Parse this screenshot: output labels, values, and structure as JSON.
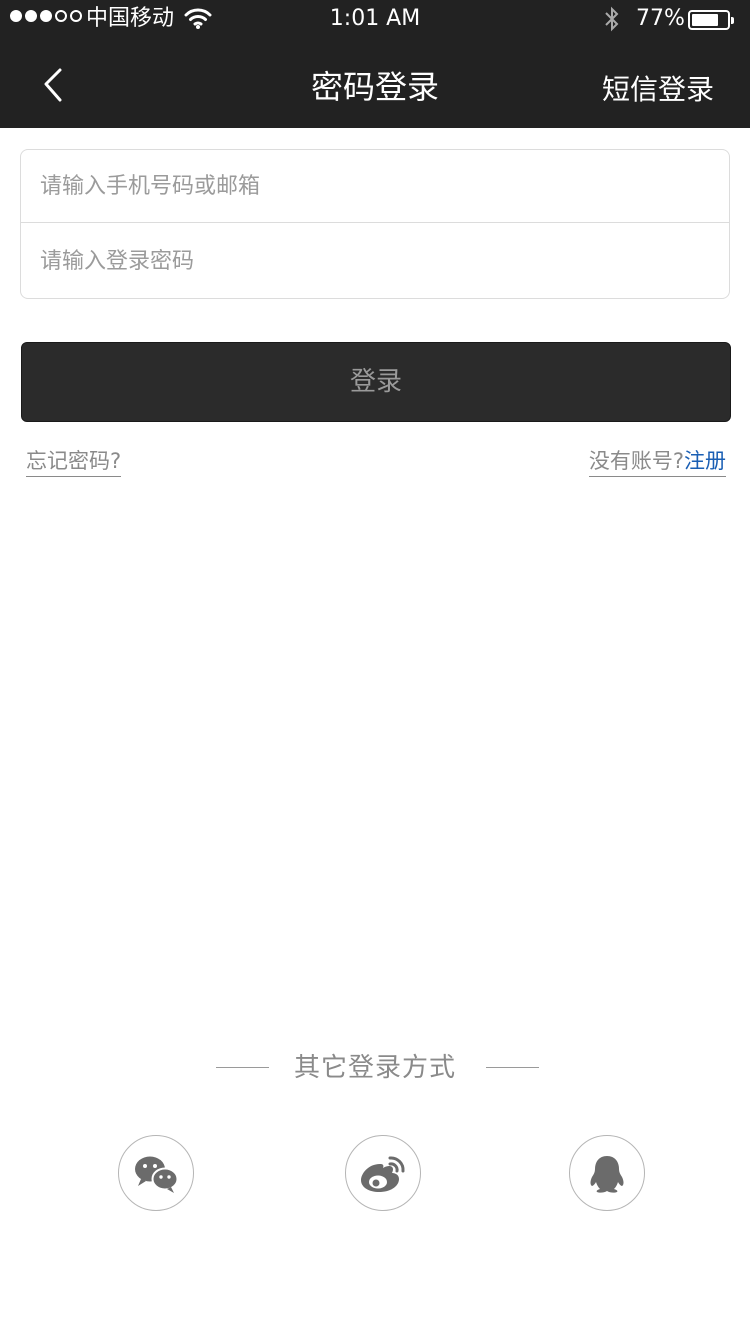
{
  "status_bar": {
    "carrier": "中国移动",
    "time": "1:01 AM",
    "battery_percent": "77%",
    "battery_level": 0.77,
    "signal_bars_filled": 3,
    "signal_bars_total": 5
  },
  "nav": {
    "title": "密码登录",
    "right_action": "短信登录",
    "back_icon": "chevron-left-icon"
  },
  "form": {
    "account_placeholder": "请输入手机号码或邮箱",
    "account_value": "",
    "password_placeholder": "请输入登录密码",
    "password_value": ""
  },
  "login_button": "登录",
  "links": {
    "forgot_password": "忘记密码?",
    "no_account": "没有账号?",
    "register": "注册"
  },
  "other_login": {
    "title": "其它登录方式",
    "methods": [
      {
        "icon": "wechat-icon"
      },
      {
        "icon": "weibo-icon"
      },
      {
        "icon": "qq-icon"
      }
    ]
  },
  "colors": {
    "header_bg": "#222222",
    "button_bg": "#2b2b2b",
    "link_blue": "#1a5fb4",
    "muted_text": "#8a8a8a"
  }
}
